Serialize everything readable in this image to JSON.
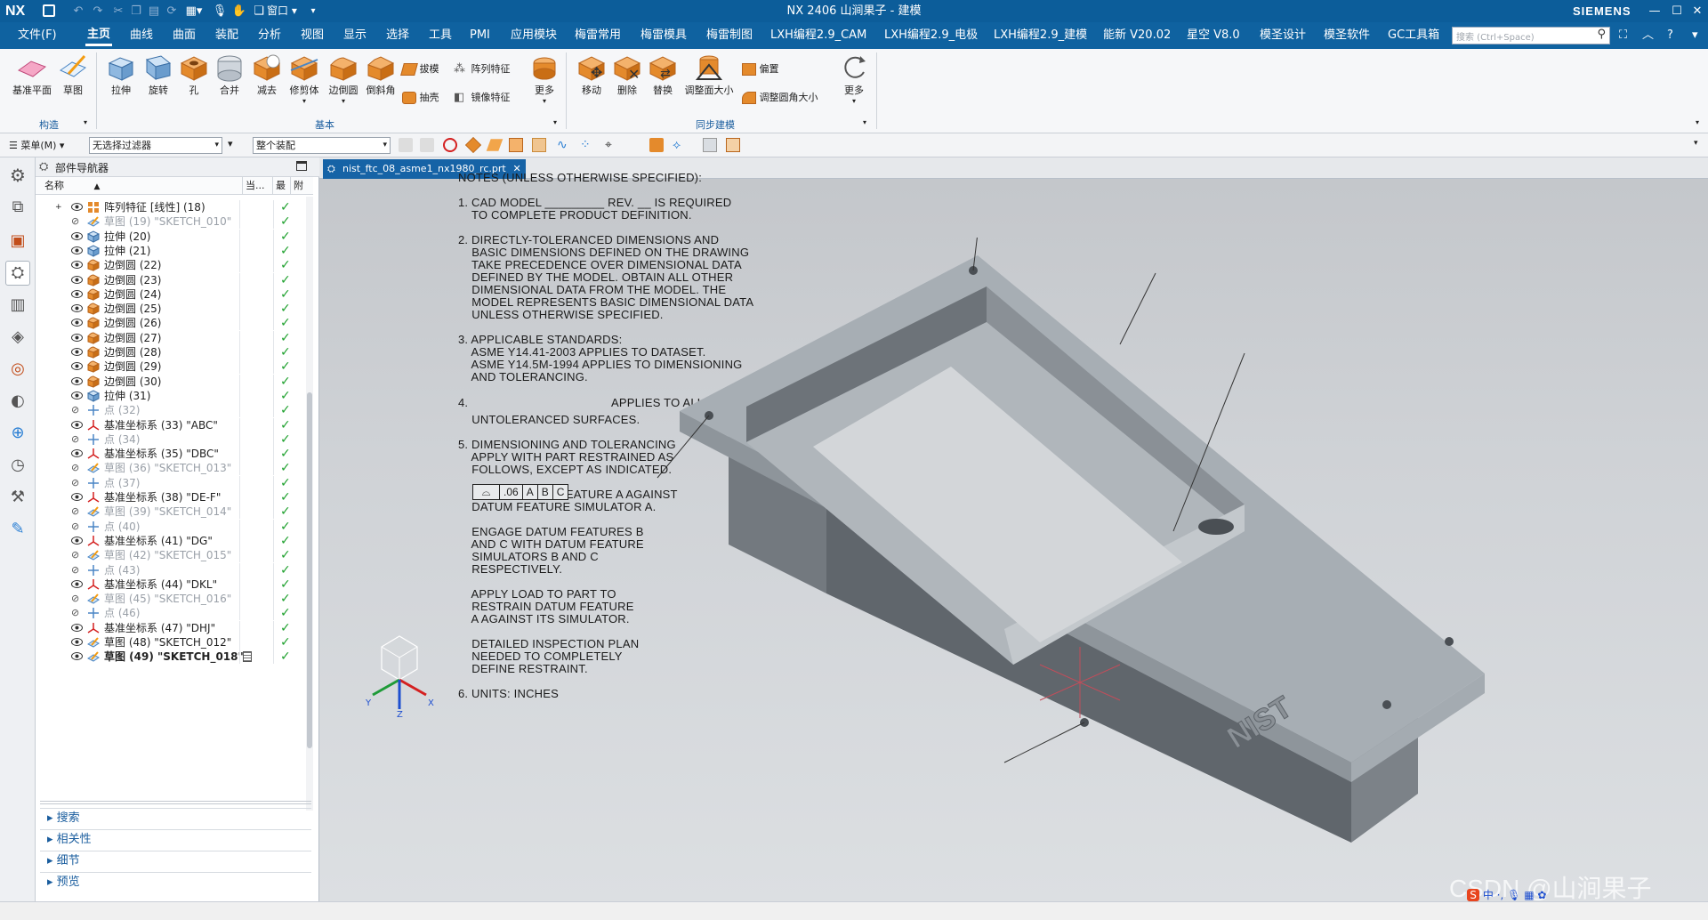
{
  "titlebar": {
    "logo": "NX",
    "window_menu": "窗口",
    "title": "NX 2406 山涧果子 - 建模",
    "brand": "SIEMENS"
  },
  "menubar": {
    "items": [
      "文件(F)",
      "主页",
      "曲线",
      "曲面",
      "装配",
      "分析",
      "视图",
      "显示",
      "选择",
      "工具",
      "PMI",
      "应用模块",
      "梅雷常用",
      "梅雷模具",
      "梅雷制图",
      "LXH编程2.9_CAM",
      "LXH编程2.9_电极",
      "LXH编程2.9_建模",
      "能新 V20.02",
      "星空 V8.0",
      "模圣设计",
      "模圣软件",
      "GC工具箱"
    ],
    "search_placeholder": "搜索 (Ctrl+Space)"
  },
  "ribbon": {
    "construct": {
      "buttons": [
        "基准平面",
        "草图"
      ],
      "label": "构造"
    },
    "basic": {
      "buttons": [
        "拉伸",
        "旋转",
        "孔",
        "合并",
        "减去",
        "修剪体",
        "边倒圆",
        "倒斜角"
      ],
      "small": [
        "拔模",
        "阵列特征",
        "抽壳",
        "镜像特征"
      ],
      "more": "更多",
      "label": "基本"
    },
    "sync": {
      "buttons": [
        "移动",
        "删除",
        "替换",
        "调整面大小"
      ],
      "small": [
        "偏置",
        "调整圆角大小"
      ],
      "more": "更多",
      "label": "同步建模"
    }
  },
  "filterbar": {
    "menu": "菜单(M)",
    "filter": "无选择过滤器",
    "scope": "整个装配"
  },
  "navigator": {
    "title": "部件导航器",
    "columns": {
      "name": "名称",
      "current": "当...",
      "latest": "最",
      "attached": "附"
    },
    "rows": [
      {
        "label": "阵列特征 [线性] (18)",
        "dim": false,
        "icon": "pattern"
      },
      {
        "label": "草图 (19) \"SKETCH_010\"",
        "dim": true,
        "icon": "sketch"
      },
      {
        "label": "拉伸 (20)",
        "dim": false,
        "icon": "extrude"
      },
      {
        "label": "拉伸 (21)",
        "dim": false,
        "icon": "extrude"
      },
      {
        "label": "边倒圆 (22)",
        "dim": false,
        "icon": "blend"
      },
      {
        "label": "边倒圆 (23)",
        "dim": false,
        "icon": "blend"
      },
      {
        "label": "边倒圆 (24)",
        "dim": false,
        "icon": "blend"
      },
      {
        "label": "边倒圆 (25)",
        "dim": false,
        "icon": "blend"
      },
      {
        "label": "边倒圆 (26)",
        "dim": false,
        "icon": "blend"
      },
      {
        "label": "边倒圆 (27)",
        "dim": false,
        "icon": "blend"
      },
      {
        "label": "边倒圆 (28)",
        "dim": false,
        "icon": "blend"
      },
      {
        "label": "边倒圆 (29)",
        "dim": false,
        "icon": "blend"
      },
      {
        "label": "边倒圆 (30)",
        "dim": false,
        "icon": "blend"
      },
      {
        "label": "拉伸 (31)",
        "dim": false,
        "icon": "extrude"
      },
      {
        "label": "点 (32)",
        "dim": true,
        "icon": "point"
      },
      {
        "label": "基准坐标系 (33) \"ABC\"",
        "dim": false,
        "icon": "csys"
      },
      {
        "label": "点 (34)",
        "dim": true,
        "icon": "point"
      },
      {
        "label": "基准坐标系 (35) \"DBC\"",
        "dim": false,
        "icon": "csys"
      },
      {
        "label": "草图 (36) \"SKETCH_013\"",
        "dim": true,
        "icon": "sketch"
      },
      {
        "label": "点 (37)",
        "dim": true,
        "icon": "point"
      },
      {
        "label": "基准坐标系 (38) \"DE-F\"",
        "dim": false,
        "icon": "csys"
      },
      {
        "label": "草图 (39) \"SKETCH_014\"",
        "dim": true,
        "icon": "sketch"
      },
      {
        "label": "点 (40)",
        "dim": true,
        "icon": "point"
      },
      {
        "label": "基准坐标系 (41) \"DG\"",
        "dim": false,
        "icon": "csys"
      },
      {
        "label": "草图 (42) \"SKETCH_015\"",
        "dim": true,
        "icon": "sketch"
      },
      {
        "label": "点 (43)",
        "dim": true,
        "icon": "point"
      },
      {
        "label": "基准坐标系 (44) \"DKL\"",
        "dim": false,
        "icon": "csys"
      },
      {
        "label": "草图 (45) \"SKETCH_016\"",
        "dim": true,
        "icon": "sketch"
      },
      {
        "label": "点 (46)",
        "dim": true,
        "icon": "point"
      },
      {
        "label": "基准坐标系 (47) \"DHJ\"",
        "dim": false,
        "icon": "csys"
      },
      {
        "label": "草图 (48) \"SKETCH_012\"",
        "dim": false,
        "icon": "sketch"
      },
      {
        "label": "草图 (49) \"SKETCH_018\"",
        "dim": false,
        "icon": "sketch",
        "bold": true
      }
    ],
    "sections": [
      "搜索",
      "相关性",
      "细节",
      "预览"
    ]
  },
  "tab": {
    "label": "nist_ftc_08_asme1_nx1980_rc.prt"
  },
  "notes": [
    "NOTES (UNLESS OTHERWISE SPECIFIED):",
    "1. CAD MODEL _________ REV. __ IS REQUIRED",
    "    TO COMPLETE PRODUCT DEFINITION.",
    "2. DIRECTLY-TOLERANCED DIMENSIONS AND",
    "    BASIC DIMENSIONS DEFINED ON THE DRAWING",
    "    TAKE PRECEDENCE OVER DIMENSIONAL DATA",
    "    DEFINED BY THE MODEL. OBTAIN ALL OTHER",
    "    DIMENSIONAL DATA FROM THE MODEL. THE",
    "    MODEL REPRESENTS BASIC DIMENSIONAL DATA",
    "    UNLESS OTHERWISE SPECIFIED.",
    "3. APPLICABLE STANDARDS:",
    "    ASME Y14.41-2003 APPLIES TO DATASET.",
    "    ASME Y14.5M-1994 APPLIES TO DIMENSIONING",
    "    AND TOLERANCING.",
    "4.",
    "APPLIES TO ALL",
    "    UNTOLERANCED SURFACES.",
    "5. DIMENSIONING AND TOLERANCING",
    "    APPLY WITH PART RESTRAINED AS",
    "    FOLLOWS, EXCEPT AS INDICATED.",
    "    PLACE DATUM FEATURE A AGAINST",
    "    DATUM FEATURE SIMULATOR A.",
    "    ENGAGE DATUM FEATURES B",
    "    AND C WITH DATUM FEATURE",
    "    SIMULATORS B AND C",
    "    RESPECTIVELY.",
    "    APPLY LOAD TO PART TO",
    "    RESTRAIN DATUM FEATURE",
    "    A AGAINST ITS SIMULATOR.",
    "    DETAILED INSPECTION PLAN",
    "    NEEDED TO COMPLETELY",
    "    DEFINE RESTRAINT.",
    "6. UNITS: INCHES"
  ],
  "fcf": {
    "tol": ".06",
    "d1": "A",
    "d2": "B",
    "d3": "C"
  },
  "triad": {
    "x": "X",
    "y": "Y",
    "z": "Z"
  },
  "part_engraving": "NIST",
  "watermark": "CSDN @山涧果子",
  "ime": {
    "lang": "中"
  }
}
